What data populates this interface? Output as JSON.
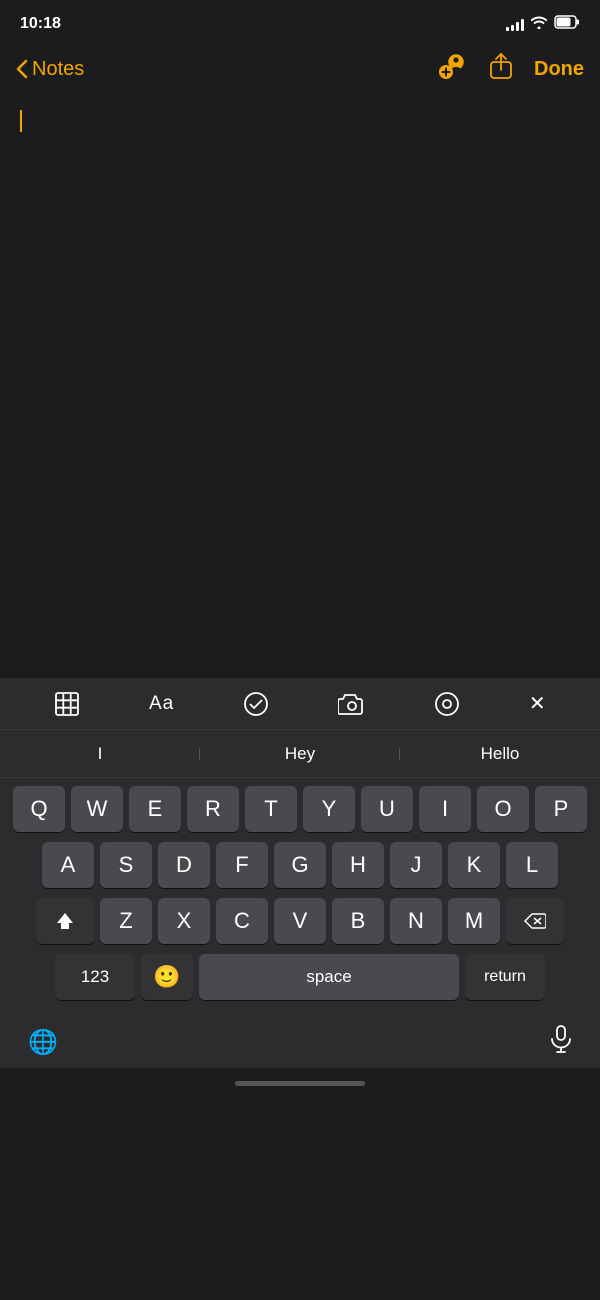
{
  "statusBar": {
    "time": "10:18",
    "signal": [
      3,
      5,
      7,
      9,
      11
    ],
    "battery": "75"
  },
  "navBar": {
    "backLabel": "Notes",
    "doneLabel": "Done"
  },
  "toolbar": {
    "table_icon": "⊞",
    "format_icon": "Aa",
    "checklist_icon": "✓",
    "camera_icon": "📷",
    "markup_icon": "✏",
    "close_icon": "✕"
  },
  "predictive": {
    "suggestions": [
      "I",
      "Hey",
      "Hello"
    ]
  },
  "keyboard": {
    "row1": [
      "Q",
      "W",
      "E",
      "R",
      "T",
      "Y",
      "U",
      "I",
      "O",
      "P"
    ],
    "row2": [
      "A",
      "S",
      "D",
      "F",
      "G",
      "H",
      "J",
      "K",
      "L"
    ],
    "row3": [
      "Z",
      "X",
      "C",
      "V",
      "B",
      "N",
      "M"
    ],
    "bottomLeft": "123",
    "emoji": "🙂",
    "space": "space",
    "returnLabel": "return",
    "globe": "🌐",
    "mic": "🎤"
  }
}
